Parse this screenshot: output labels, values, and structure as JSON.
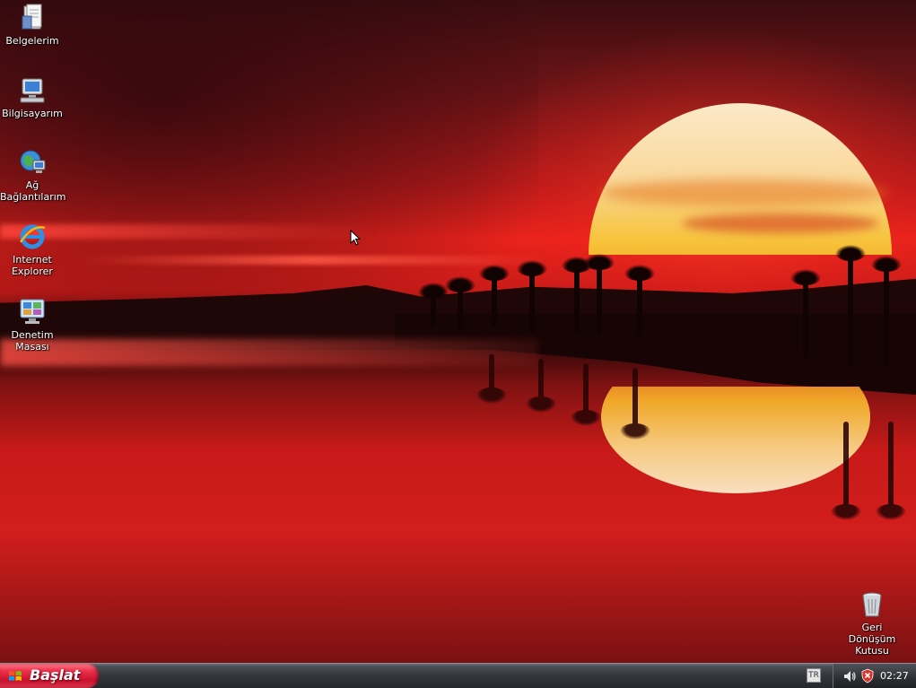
{
  "desktop": {
    "icons": [
      {
        "label": "Belgelerim",
        "icon": "documents-folder-icon"
      },
      {
        "label": "Bilgisayarım",
        "icon": "computer-icon"
      },
      {
        "label_line1": "Ağ",
        "label_line2": "Bağlantılarım",
        "icon": "network-icon"
      },
      {
        "label_line1": "Internet",
        "label_line2": "Explorer",
        "icon": "internet-explorer-icon"
      },
      {
        "label": "Denetim Masası",
        "icon": "control-panel-icon"
      }
    ],
    "recycle_bin": {
      "label_line1": "Geri Dönüşüm",
      "label_line2": "Kutusu",
      "icon": "recycle-bin-icon"
    }
  },
  "taskbar": {
    "start_label": "Başlat",
    "language": "TR",
    "clock": "02:27"
  },
  "colors": {
    "start_button": "#e0384e",
    "taskbar": "#33363b"
  }
}
